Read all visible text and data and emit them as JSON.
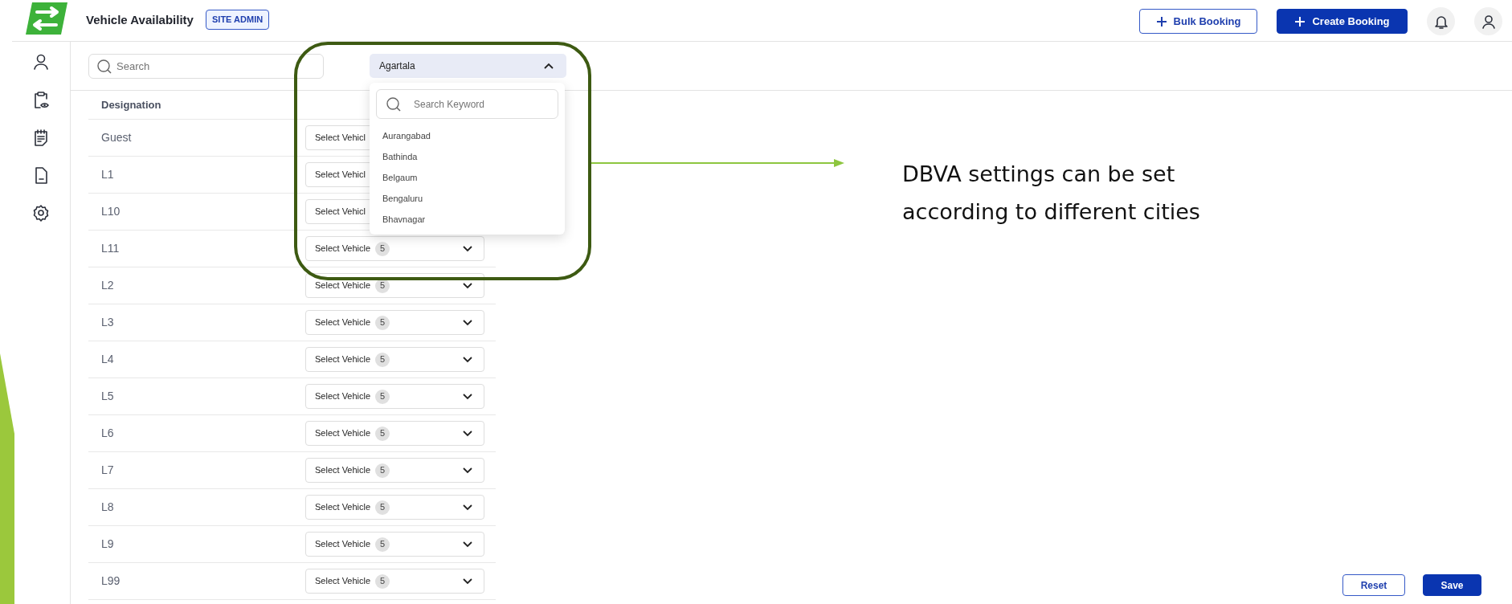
{
  "header": {
    "title": "Vehicle Availability",
    "role_badge": "SITE ADMIN",
    "buttons": [
      {
        "label": "Bulk Booking",
        "kind": "outline"
      },
      {
        "label": "Create Booking",
        "kind": "primary"
      }
    ]
  },
  "filters": {
    "search": {
      "placeholder": "Search"
    },
    "city": {
      "value": "Agartala",
      "expanded": true,
      "dropdown": {
        "placeholder": "Search Keyword",
        "options": [
          "Aurangabad",
          "Bathinda",
          "Belgaum",
          "Bengaluru",
          "Bhavnagar"
        ]
      }
    }
  },
  "table": {
    "column": "Designation",
    "rows": [
      {
        "designation": "Guest",
        "vehicle": "Select Vehicl"
      },
      {
        "designation": "L1",
        "vehicle": "Select Vehicl"
      },
      {
        "designation": "L10",
        "vehicle": "Select Vehicl"
      },
      {
        "designation": "L11",
        "vehicle": "Select Vehicle",
        "count": "5"
      },
      {
        "designation": "L2",
        "vehicle": "Select Vehicle",
        "count": "5"
      },
      {
        "designation": "L3",
        "vehicle": "Select Vehicle",
        "count": "5"
      },
      {
        "designation": "L4",
        "vehicle": "Select Vehicle",
        "count": "5"
      },
      {
        "designation": "L5",
        "vehicle": "Select Vehicle",
        "count": "5"
      },
      {
        "designation": "L6",
        "vehicle": "Select Vehicle",
        "count": "5"
      },
      {
        "designation": "L7",
        "vehicle": "Select Vehicle",
        "count": "5"
      },
      {
        "designation": "L8",
        "vehicle": "Select Vehicle",
        "count": "5"
      },
      {
        "designation": "L9",
        "vehicle": "Select Vehicle",
        "count": "5"
      },
      {
        "designation": "L99",
        "vehicle": "Select Vehicle",
        "count": "5"
      }
    ]
  },
  "actions": [
    {
      "label": "Reset",
      "kind": "outline"
    },
    {
      "label": "Save",
      "kind": "primary"
    }
  ],
  "annotation": {
    "text": "DBVA settings can be set according to different cities"
  }
}
